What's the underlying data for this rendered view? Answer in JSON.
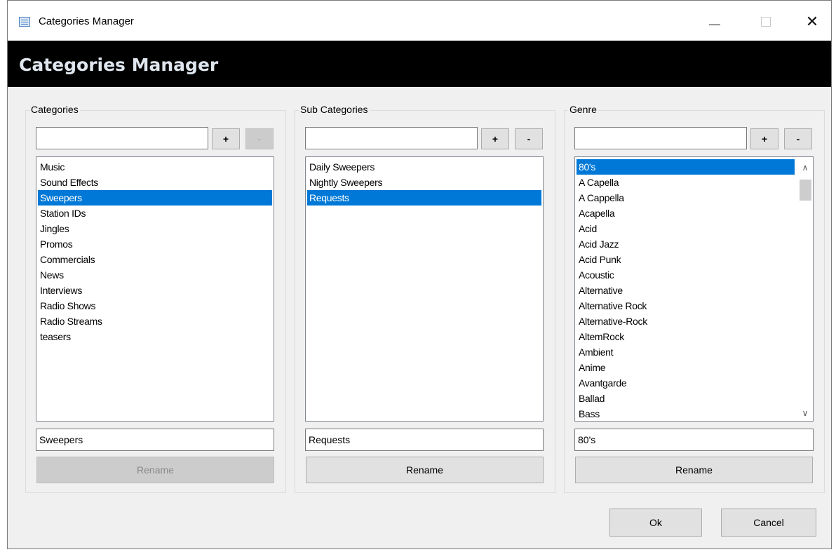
{
  "window": {
    "title": "Categories Manager",
    "header": "Categories Manager"
  },
  "categories": {
    "label": "Categories",
    "input_value": "",
    "add_label": "+",
    "remove_label": "-",
    "items": [
      "Music",
      "Sound Effects",
      "Sweepers",
      "Station IDs",
      "Jingles",
      "Promos",
      "Commercials",
      "News",
      "Interviews",
      "Radio Shows",
      "Radio Streams",
      "teasers"
    ],
    "selected": "Sweepers",
    "rename_value": "Sweepers",
    "rename_label": "Rename"
  },
  "subcategories": {
    "label": "Sub Categories",
    "input_value": "",
    "add_label": "+",
    "remove_label": "-",
    "items": [
      "Daily Sweepers",
      "Nightly Sweepers",
      "Requests"
    ],
    "selected": "Requests",
    "rename_value": "Requests",
    "rename_label": "Rename"
  },
  "genre": {
    "label": "Genre",
    "input_value": "",
    "add_label": "+",
    "remove_label": "-",
    "items": [
      "80's",
      "A Capella",
      "A Cappella",
      "Acapella",
      "Acid",
      "Acid Jazz",
      "Acid Punk",
      "Acoustic",
      "Alternative",
      "Alternative Rock",
      "Alternative-Rock",
      "AltemRock",
      "Ambient",
      "Anime",
      "Avantgarde",
      "Ballad",
      "Bass"
    ],
    "selected": "80's",
    "rename_value": "80's",
    "rename_label": "Rename"
  },
  "footer": {
    "ok_label": "Ok",
    "cancel_label": "Cancel"
  },
  "colors": {
    "selection": "#0078d7",
    "header_bg": "#000000",
    "header_text": "#dfe6ee"
  },
  "icons": [
    "app-list-icon",
    "minimize-icon",
    "maximize-icon",
    "close-icon",
    "scroll-up-icon",
    "scroll-down-icon"
  ]
}
